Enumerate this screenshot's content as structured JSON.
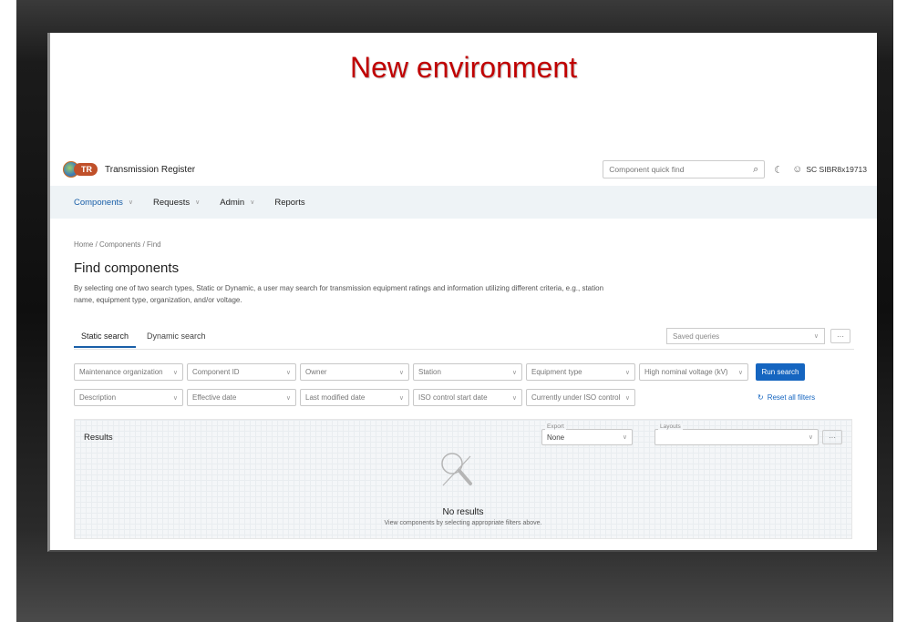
{
  "slide": {
    "title": "New environment"
  },
  "header": {
    "logo_text": "TR",
    "app_name": "Transmission Register",
    "quick_find_placeholder": "Component quick find",
    "user": "SC SIBR8x19713"
  },
  "nav": {
    "items": [
      {
        "label": "Components",
        "has_menu": true,
        "active": true
      },
      {
        "label": "Requests",
        "has_menu": true
      },
      {
        "label": "Admin",
        "has_menu": true
      },
      {
        "label": "Reports",
        "has_menu": false
      }
    ]
  },
  "breadcrumb": "Home  /  Components  /  Find",
  "page": {
    "title": "Find components",
    "description": "By selecting one of two search types, Static or Dynamic, a user may search for transmission equipment ratings and information utilizing different criteria, e.g., station name, equipment type, organization, and/or voltage."
  },
  "tabs": [
    "Static search",
    "Dynamic search"
  ],
  "saved_queries_placeholder": "Saved queries",
  "more_label": "···",
  "filters_row1": [
    "Maintenance organization",
    "Component ID",
    "Owner",
    "Station",
    "Equipment type",
    "High nominal voltage (kV)"
  ],
  "filters_row2": [
    "Description",
    "Effective date",
    "Last modified date",
    "ISO control start date",
    "Currently under ISO control"
  ],
  "run_search_label": "Run search",
  "reset_label": "Reset all filters",
  "results": {
    "title": "Results",
    "export_label": "Export",
    "export_value": "None",
    "layouts_label": "Layouts",
    "no_results": "No results",
    "no_results_sub": "View components by selecting appropriate filters above."
  },
  "colors": {
    "accent": "#1565c0",
    "title_red": "#c00000",
    "logo_orange": "#c0502a"
  }
}
